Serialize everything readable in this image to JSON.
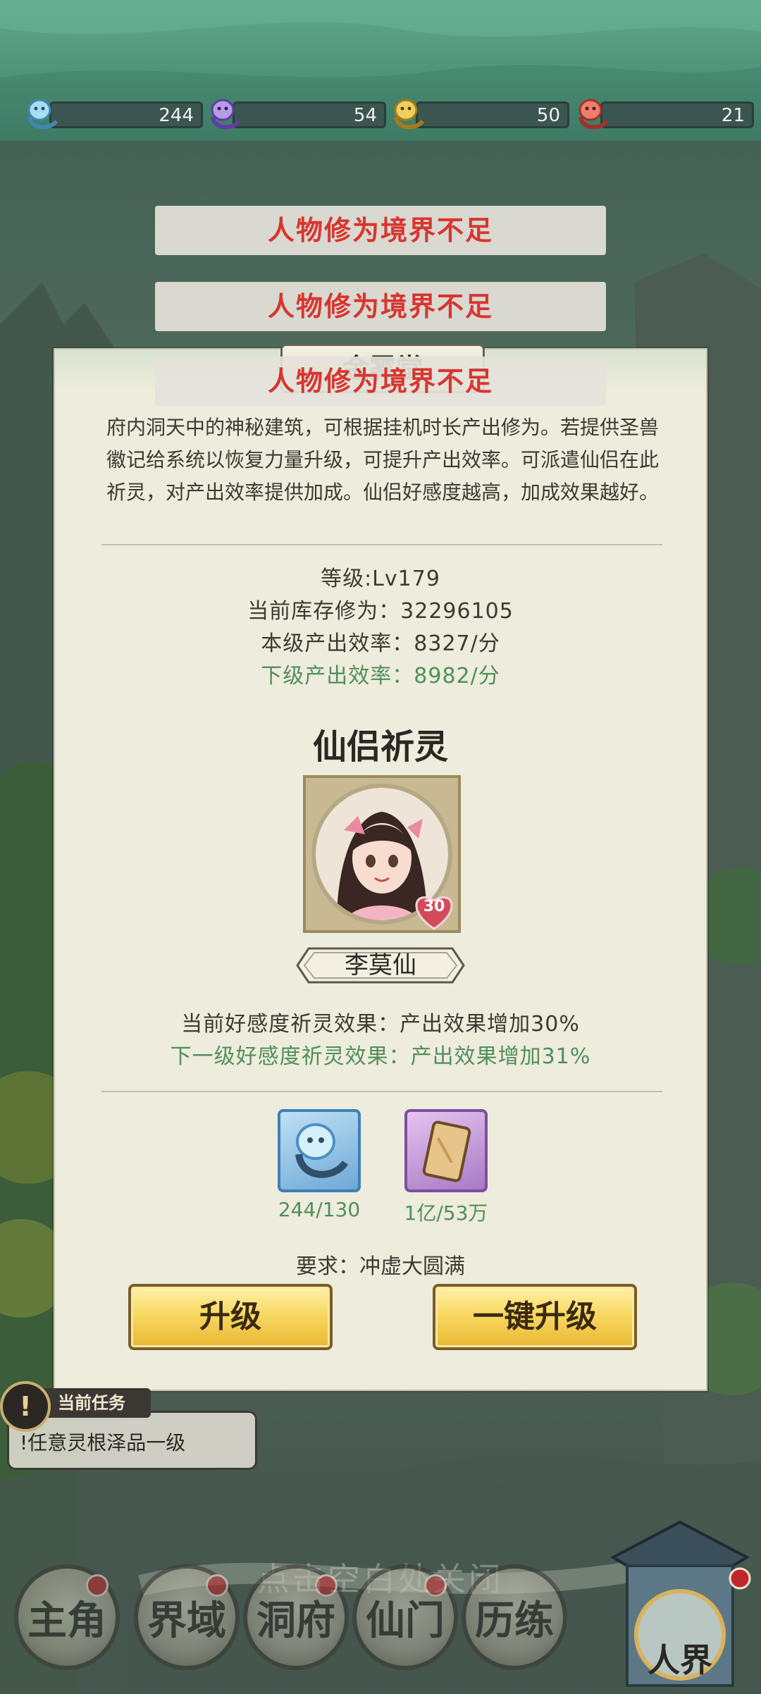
{
  "resources": [
    {
      "icon": "blue-spirit-icon",
      "value": "244",
      "color": "#7fc6e8"
    },
    {
      "icon": "purple-spirit-icon",
      "value": "54",
      "color": "#8b63c9"
    },
    {
      "icon": "gold-spirit-icon",
      "value": "50",
      "color": "#e0b640"
    },
    {
      "icon": "red-spirit-icon",
      "value": "21",
      "color": "#d9473c"
    }
  ],
  "toasts": [
    "人物修为境界不足",
    "人物修为境界不足",
    "人物修为境界不足"
  ],
  "dialog": {
    "title": "金雾堂",
    "description": "府内洞天中的神秘建筑，可根据挂机时长产出修为。若提供圣兽徽记给系统以恢复力量升级，可提升产出效率。可派遣仙侣在此祈灵，对产出效率提供加成。仙侣好感度越高，加成效果越好。",
    "stats": {
      "level": "等级:Lv179",
      "stock": "当前库存修为：32296105",
      "current_rate": "本级产出效率：8327/分",
      "next_rate": "下级产出效率：8982/分"
    },
    "companion_section_title": "仙侣祈灵",
    "companion": {
      "name": "李莫仙",
      "affinity": "30",
      "current_effect": "当前好感度祈灵效果：产出效果增加30%",
      "next_effect": "下一级好感度祈灵效果：产出效果增加31%"
    },
    "materials": [
      {
        "icon": "blue-spirit-icon",
        "count": "244/130"
      },
      {
        "icon": "talisman-card-icon",
        "count": "1亿/53万"
      }
    ],
    "requirement": "要求：冲虚大圆满",
    "buttons": {
      "upgrade": "升级",
      "upgrade_all": "一键升级"
    }
  },
  "task": {
    "label": "当前任务",
    "text": "!任意灵根泽品一级"
  },
  "close_hint": "点击空白处关闭",
  "bottom_nav": [
    "主角",
    "界域",
    "洞府",
    "仙门",
    "历练"
  ],
  "world_button": "人界",
  "colors": {
    "accent_green": "#4f8f5c",
    "toast_red": "#d8352f",
    "button_gold": "#f7d65c"
  }
}
